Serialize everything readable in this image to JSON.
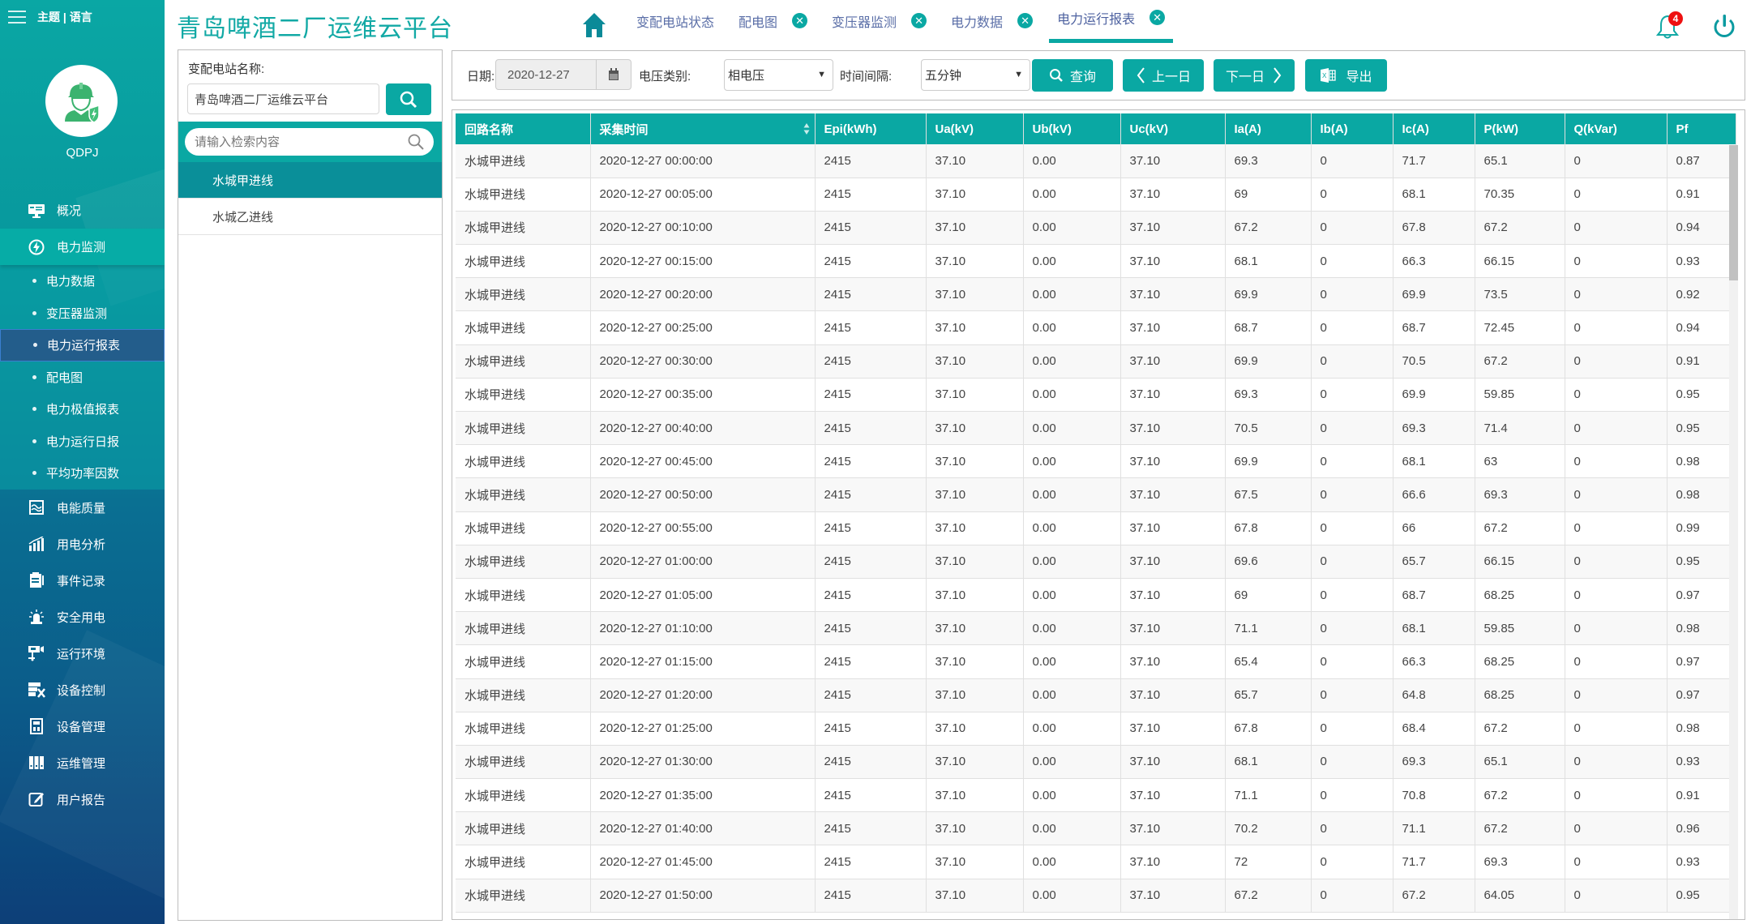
{
  "sidebar": {
    "theme_lang": "主题 | 语言",
    "user_name": "QDPJ",
    "items": [
      {
        "label": "概况",
        "icon": "monitor-icon"
      },
      {
        "label": "电力监测",
        "icon": "lightning-icon",
        "active": true,
        "children": [
          {
            "label": "电力数据"
          },
          {
            "label": "变压器监测"
          },
          {
            "label": "电力运行报表",
            "active": true
          },
          {
            "label": "配电图"
          },
          {
            "label": "电力极值报表"
          },
          {
            "label": "电力运行日报"
          },
          {
            "label": "平均功率因数"
          }
        ]
      },
      {
        "label": "电能质量",
        "icon": "wave-chart-icon"
      },
      {
        "label": "用电分析",
        "icon": "bar-chart-icon"
      },
      {
        "label": "事件记录",
        "icon": "clipboard-icon"
      },
      {
        "label": "安全用电",
        "icon": "alarm-light-icon"
      },
      {
        "label": "运行环境",
        "icon": "camera-icon"
      },
      {
        "label": "设备控制",
        "icon": "device-tools-icon"
      },
      {
        "label": "设备管理",
        "icon": "device-icon"
      },
      {
        "label": "运维管理",
        "icon": "cabinet-icon"
      },
      {
        "label": "用户报告",
        "icon": "edit-icon"
      }
    ]
  },
  "header": {
    "title": "青岛啤酒二厂运维云平台",
    "tabs": [
      {
        "label": "变配电站状态",
        "closable": false
      },
      {
        "label": "配电图",
        "closable": true
      },
      {
        "label": "变压器监测",
        "closable": true
      },
      {
        "label": "电力数据",
        "closable": true
      },
      {
        "label": "电力运行报表",
        "closable": true,
        "active": true
      }
    ],
    "close_glyph": "✕",
    "notification_count": "4",
    "accent_color": "#0aa8a3"
  },
  "left_panel": {
    "station_label": "变配电站名称:",
    "station_value": "青岛啤酒二厂运维云平台",
    "filter_placeholder": "请输入检索内容",
    "stations": [
      {
        "name": "水城甲进线",
        "selected": true
      },
      {
        "name": "水城乙进线",
        "selected": false
      }
    ]
  },
  "toolbar": {
    "date_label": "日期:",
    "date_value": "2020-12-27",
    "voltage_label": "电压类别:",
    "voltage_value": "相电压",
    "interval_label": "时间间隔:",
    "interval_value": "五分钟",
    "query_label": "查询",
    "prev_label": "上一日",
    "next_label": "下一日",
    "export_label": "导出"
  },
  "table": {
    "columns": [
      "回路名称",
      "采集时间",
      "Epi(kWh)",
      "Ua(kV)",
      "Ub(kV)",
      "Uc(kV)",
      "Ia(A)",
      "Ib(A)",
      "Ic(A)",
      "P(kW)",
      "Q(kVar)",
      "Pf"
    ],
    "rows": [
      [
        "水城甲进线",
        "2020-12-27 00:00:00",
        "2415",
        "37.10",
        "0.00",
        "37.10",
        "69.3",
        "0",
        "71.7",
        "65.1",
        "0",
        "0.87"
      ],
      [
        "水城甲进线",
        "2020-12-27 00:05:00",
        "2415",
        "37.10",
        "0.00",
        "37.10",
        "69",
        "0",
        "68.1",
        "70.35",
        "0",
        "0.91"
      ],
      [
        "水城甲进线",
        "2020-12-27 00:10:00",
        "2415",
        "37.10",
        "0.00",
        "37.10",
        "67.2",
        "0",
        "67.8",
        "67.2",
        "0",
        "0.94"
      ],
      [
        "水城甲进线",
        "2020-12-27 00:15:00",
        "2415",
        "37.10",
        "0.00",
        "37.10",
        "68.1",
        "0",
        "66.3",
        "66.15",
        "0",
        "0.93"
      ],
      [
        "水城甲进线",
        "2020-12-27 00:20:00",
        "2415",
        "37.10",
        "0.00",
        "37.10",
        "69.9",
        "0",
        "69.9",
        "73.5",
        "0",
        "0.92"
      ],
      [
        "水城甲进线",
        "2020-12-27 00:25:00",
        "2415",
        "37.10",
        "0.00",
        "37.10",
        "68.7",
        "0",
        "68.7",
        "72.45",
        "0",
        "0.94"
      ],
      [
        "水城甲进线",
        "2020-12-27 00:30:00",
        "2415",
        "37.10",
        "0.00",
        "37.10",
        "69.9",
        "0",
        "70.5",
        "67.2",
        "0",
        "0.91"
      ],
      [
        "水城甲进线",
        "2020-12-27 00:35:00",
        "2415",
        "37.10",
        "0.00",
        "37.10",
        "69.3",
        "0",
        "69.9",
        "59.85",
        "0",
        "0.95"
      ],
      [
        "水城甲进线",
        "2020-12-27 00:40:00",
        "2415",
        "37.10",
        "0.00",
        "37.10",
        "70.5",
        "0",
        "69.3",
        "71.4",
        "0",
        "0.95"
      ],
      [
        "水城甲进线",
        "2020-12-27 00:45:00",
        "2415",
        "37.10",
        "0.00",
        "37.10",
        "69.9",
        "0",
        "68.1",
        "63",
        "0",
        "0.98"
      ],
      [
        "水城甲进线",
        "2020-12-27 00:50:00",
        "2415",
        "37.10",
        "0.00",
        "37.10",
        "67.5",
        "0",
        "66.6",
        "69.3",
        "0",
        "0.98"
      ],
      [
        "水城甲进线",
        "2020-12-27 00:55:00",
        "2415",
        "37.10",
        "0.00",
        "37.10",
        "67.8",
        "0",
        "66",
        "67.2",
        "0",
        "0.99"
      ],
      [
        "水城甲进线",
        "2020-12-27 01:00:00",
        "2415",
        "37.10",
        "0.00",
        "37.10",
        "69.6",
        "0",
        "65.7",
        "66.15",
        "0",
        "0.95"
      ],
      [
        "水城甲进线",
        "2020-12-27 01:05:00",
        "2415",
        "37.10",
        "0.00",
        "37.10",
        "69",
        "0",
        "68.7",
        "68.25",
        "0",
        "0.97"
      ],
      [
        "水城甲进线",
        "2020-12-27 01:10:00",
        "2415",
        "37.10",
        "0.00",
        "37.10",
        "71.1",
        "0",
        "68.1",
        "59.85",
        "0",
        "0.98"
      ],
      [
        "水城甲进线",
        "2020-12-27 01:15:00",
        "2415",
        "37.10",
        "0.00",
        "37.10",
        "65.4",
        "0",
        "66.3",
        "68.25",
        "0",
        "0.97"
      ],
      [
        "水城甲进线",
        "2020-12-27 01:20:00",
        "2415",
        "37.10",
        "0.00",
        "37.10",
        "65.7",
        "0",
        "64.8",
        "68.25",
        "0",
        "0.97"
      ],
      [
        "水城甲进线",
        "2020-12-27 01:25:00",
        "2415",
        "37.10",
        "0.00",
        "37.10",
        "67.8",
        "0",
        "68.4",
        "67.2",
        "0",
        "0.98"
      ],
      [
        "水城甲进线",
        "2020-12-27 01:30:00",
        "2415",
        "37.10",
        "0.00",
        "37.10",
        "68.1",
        "0",
        "69.3",
        "65.1",
        "0",
        "0.93"
      ],
      [
        "水城甲进线",
        "2020-12-27 01:35:00",
        "2415",
        "37.10",
        "0.00",
        "37.10",
        "71.1",
        "0",
        "70.8",
        "67.2",
        "0",
        "0.91"
      ],
      [
        "水城甲进线",
        "2020-12-27 01:40:00",
        "2415",
        "37.10",
        "0.00",
        "37.10",
        "70.2",
        "0",
        "71.1",
        "67.2",
        "0",
        "0.96"
      ],
      [
        "水城甲进线",
        "2020-12-27 01:45:00",
        "2415",
        "37.10",
        "0.00",
        "37.10",
        "72",
        "0",
        "71.7",
        "69.3",
        "0",
        "0.93"
      ],
      [
        "水城甲进线",
        "2020-12-27 01:50:00",
        "2415",
        "37.10",
        "0.00",
        "37.10",
        "67.2",
        "0",
        "67.2",
        "64.05",
        "0",
        "0.95"
      ]
    ]
  }
}
